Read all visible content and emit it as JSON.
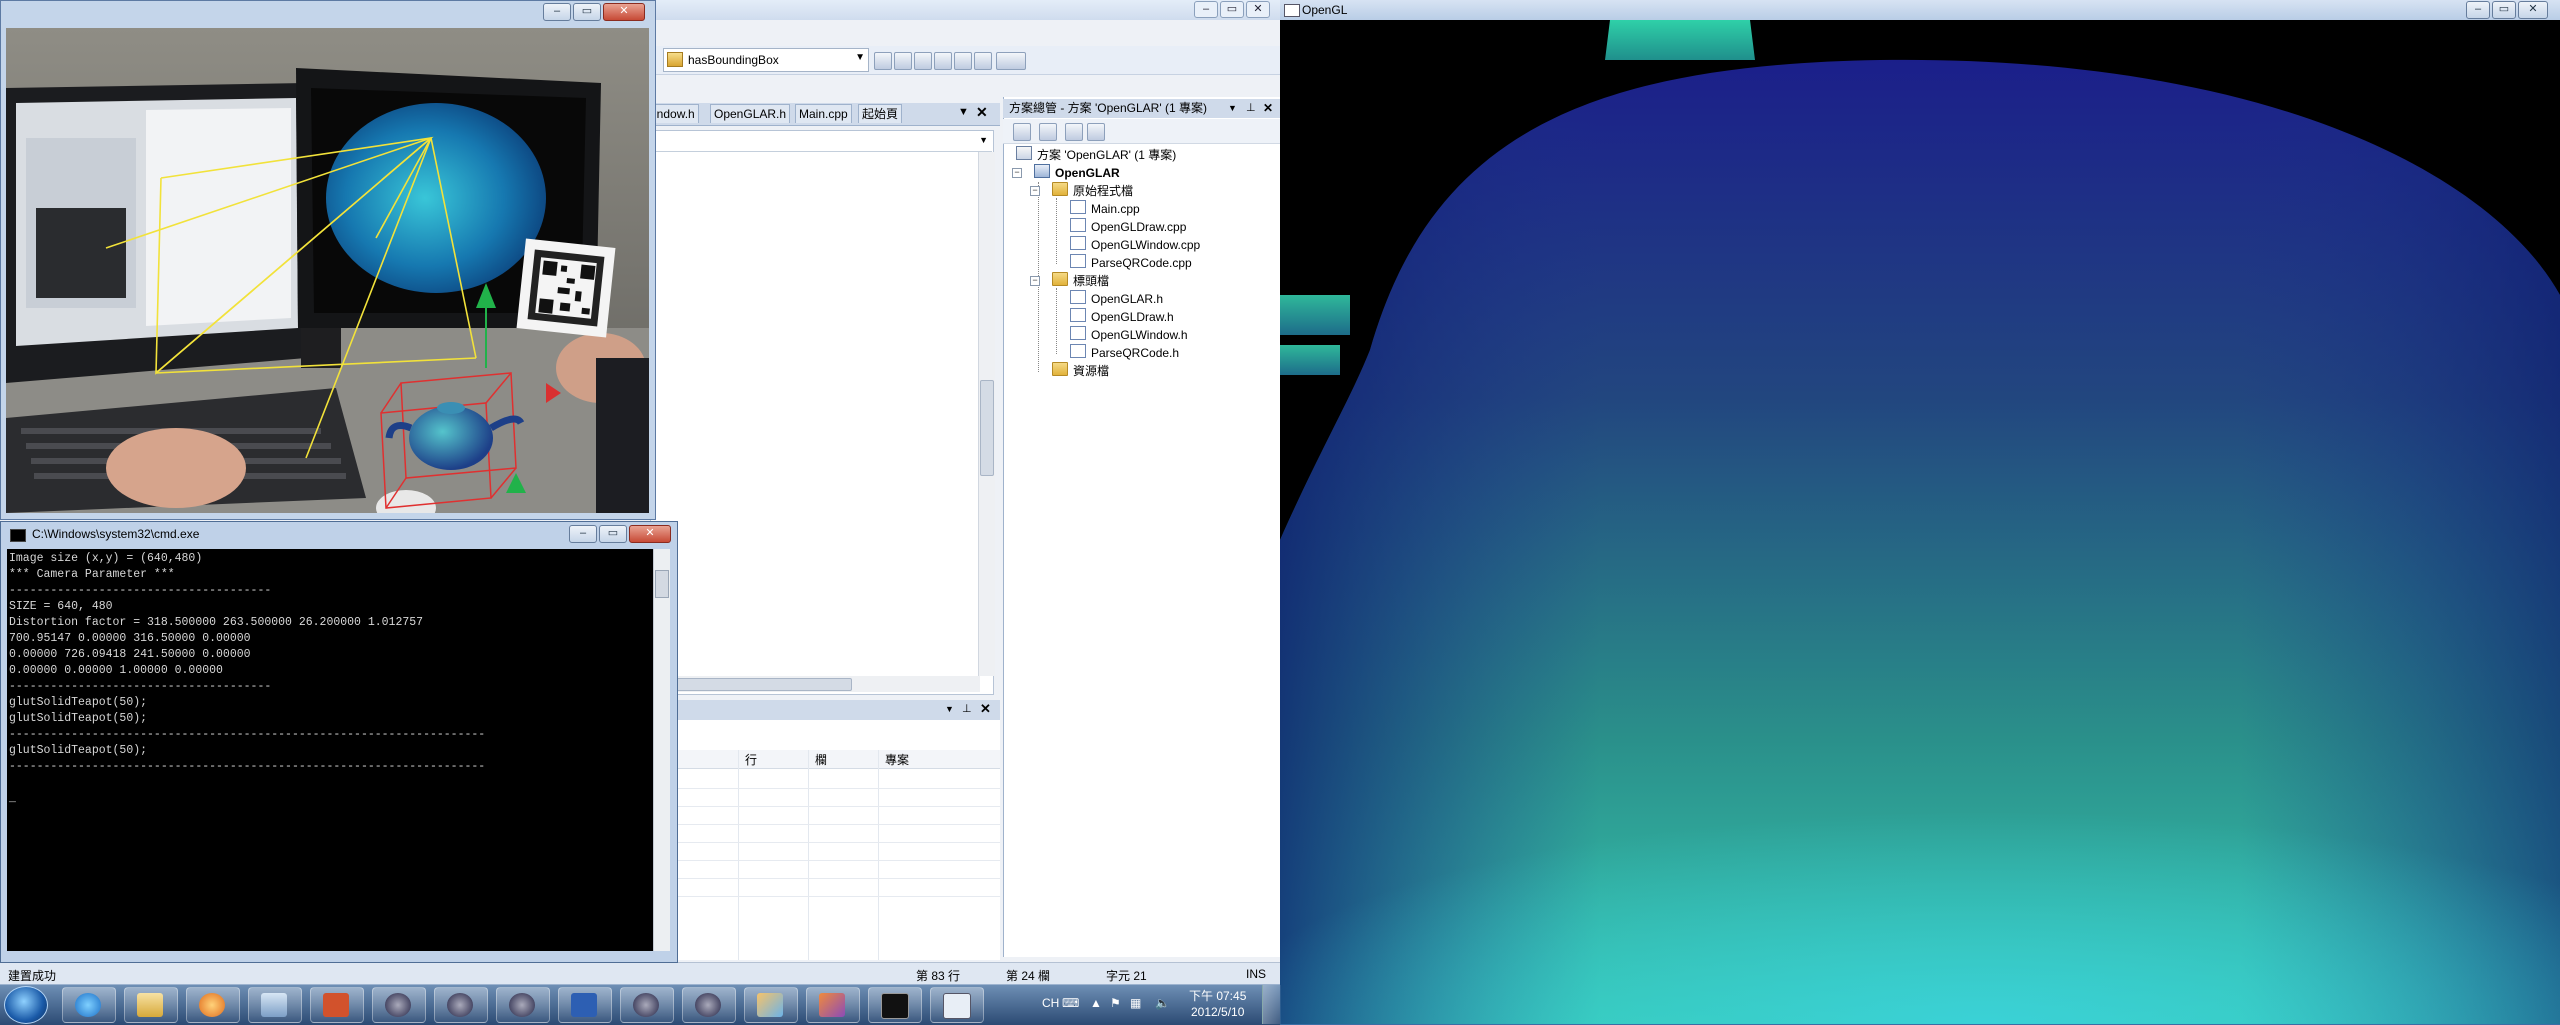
{
  "vs": {
    "config_value": "hasBoundingBox",
    "tabs": [
      "indow.h",
      "OpenGLAR.h",
      "Main.cpp",
      "起始頁"
    ],
    "output_columns": [
      "行",
      "欄",
      "專案"
    ],
    "solution_explorer": {
      "title": "方案總管 - 方案 'OpenGLAR' (1 專案)",
      "solution": "方案 'OpenGLAR' (1 專案)",
      "project": "OpenGLAR",
      "source_folder": "原始程式檔",
      "source_files": [
        "Main.cpp",
        "OpenGLDraw.cpp",
        "OpenGLWindow.cpp",
        "ParseQRCode.cpp"
      ],
      "header_folder": "標頭檔",
      "header_files": [
        "OpenGLAR.h",
        "OpenGLDraw.h",
        "OpenGLWindow.h",
        "ParseQRCode.h"
      ],
      "resource_folder": "資源檔"
    },
    "status": {
      "message": "建置成功",
      "line": "第 83 行",
      "col": "第 24 欄",
      "char": "字元 21",
      "mode": "INS"
    }
  },
  "cmd": {
    "title": "C:\\Windows\\system32\\cmd.exe",
    "lines": [
      "Image size (x,y) = (640,480)",
      "*** Camera Parameter ***",
      "--------------------------------------",
      "SIZE = 640, 480",
      "Distortion factor = 318.500000 263.500000 26.200000 1.012757",
      "700.95147 0.00000 316.50000 0.00000",
      "0.00000 726.09418 241.50000 0.00000",
      "0.00000 0.00000 1.00000 0.00000",
      "--------------------------------------",
      "glutSolidTeapot(50);",
      "glutSolidTeapot(50);",
      "---------------------------------------------------------------------",
      "glutSolidTeapot(50);",
      "---------------------------------------------------------------------",
      "",
      "_"
    ]
  },
  "gl": {
    "title": "OpenGL"
  },
  "taskbar": {
    "ime": "CH",
    "time": "下午 07:45",
    "date": "2012/5/10",
    "apps": [
      "ie-icon",
      "explorer-icon",
      "media-player-icon",
      "folder-icon",
      "powerpoint-icon",
      "artoolkit-icon",
      "artoolkit-icon",
      "artoolkit-icon",
      "word-icon",
      "artoolkit-icon",
      "artoolkit-icon",
      "paint-icon",
      "visual-studio-icon",
      "cmd-icon",
      "opengl-icon"
    ]
  },
  "colors": {
    "gl_teapot_dark": "#1a2a8a",
    "gl_teapot_light": "#2fb8a0",
    "taskbar": "#2b4a73"
  }
}
